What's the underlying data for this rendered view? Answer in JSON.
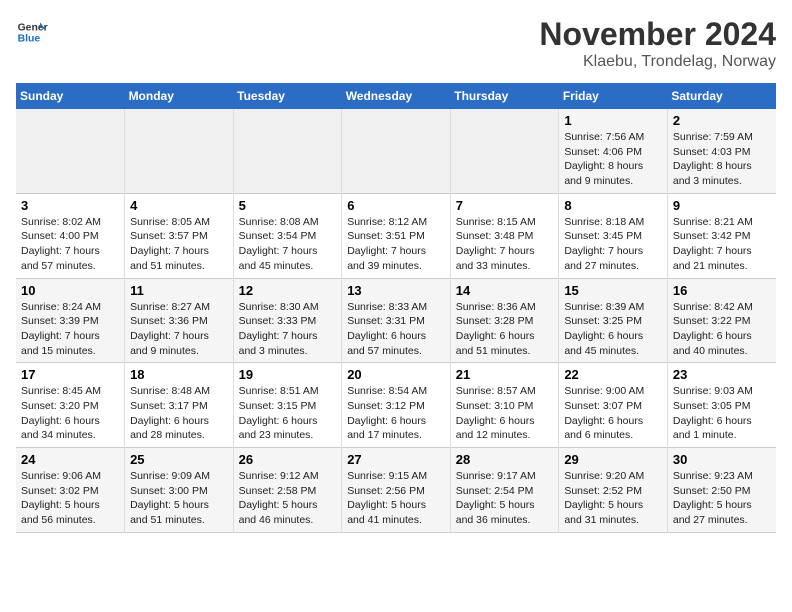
{
  "header": {
    "logo_line1": "General",
    "logo_line2": "Blue",
    "title": "November 2024",
    "subtitle": "Klaebu, Trondelag, Norway"
  },
  "weekdays": [
    "Sunday",
    "Monday",
    "Tuesday",
    "Wednesday",
    "Thursday",
    "Friday",
    "Saturday"
  ],
  "weeks": [
    [
      {
        "day": "",
        "info": ""
      },
      {
        "day": "",
        "info": ""
      },
      {
        "day": "",
        "info": ""
      },
      {
        "day": "",
        "info": ""
      },
      {
        "day": "",
        "info": ""
      },
      {
        "day": "1",
        "info": "Sunrise: 7:56 AM\nSunset: 4:06 PM\nDaylight: 8 hours and 9 minutes."
      },
      {
        "day": "2",
        "info": "Sunrise: 7:59 AM\nSunset: 4:03 PM\nDaylight: 8 hours and 3 minutes."
      }
    ],
    [
      {
        "day": "3",
        "info": "Sunrise: 8:02 AM\nSunset: 4:00 PM\nDaylight: 7 hours and 57 minutes."
      },
      {
        "day": "4",
        "info": "Sunrise: 8:05 AM\nSunset: 3:57 PM\nDaylight: 7 hours and 51 minutes."
      },
      {
        "day": "5",
        "info": "Sunrise: 8:08 AM\nSunset: 3:54 PM\nDaylight: 7 hours and 45 minutes."
      },
      {
        "day": "6",
        "info": "Sunrise: 8:12 AM\nSunset: 3:51 PM\nDaylight: 7 hours and 39 minutes."
      },
      {
        "day": "7",
        "info": "Sunrise: 8:15 AM\nSunset: 3:48 PM\nDaylight: 7 hours and 33 minutes."
      },
      {
        "day": "8",
        "info": "Sunrise: 8:18 AM\nSunset: 3:45 PM\nDaylight: 7 hours and 27 minutes."
      },
      {
        "day": "9",
        "info": "Sunrise: 8:21 AM\nSunset: 3:42 PM\nDaylight: 7 hours and 21 minutes."
      }
    ],
    [
      {
        "day": "10",
        "info": "Sunrise: 8:24 AM\nSunset: 3:39 PM\nDaylight: 7 hours and 15 minutes."
      },
      {
        "day": "11",
        "info": "Sunrise: 8:27 AM\nSunset: 3:36 PM\nDaylight: 7 hours and 9 minutes."
      },
      {
        "day": "12",
        "info": "Sunrise: 8:30 AM\nSunset: 3:33 PM\nDaylight: 7 hours and 3 minutes."
      },
      {
        "day": "13",
        "info": "Sunrise: 8:33 AM\nSunset: 3:31 PM\nDaylight: 6 hours and 57 minutes."
      },
      {
        "day": "14",
        "info": "Sunrise: 8:36 AM\nSunset: 3:28 PM\nDaylight: 6 hours and 51 minutes."
      },
      {
        "day": "15",
        "info": "Sunrise: 8:39 AM\nSunset: 3:25 PM\nDaylight: 6 hours and 45 minutes."
      },
      {
        "day": "16",
        "info": "Sunrise: 8:42 AM\nSunset: 3:22 PM\nDaylight: 6 hours and 40 minutes."
      }
    ],
    [
      {
        "day": "17",
        "info": "Sunrise: 8:45 AM\nSunset: 3:20 PM\nDaylight: 6 hours and 34 minutes."
      },
      {
        "day": "18",
        "info": "Sunrise: 8:48 AM\nSunset: 3:17 PM\nDaylight: 6 hours and 28 minutes."
      },
      {
        "day": "19",
        "info": "Sunrise: 8:51 AM\nSunset: 3:15 PM\nDaylight: 6 hours and 23 minutes."
      },
      {
        "day": "20",
        "info": "Sunrise: 8:54 AM\nSunset: 3:12 PM\nDaylight: 6 hours and 17 minutes."
      },
      {
        "day": "21",
        "info": "Sunrise: 8:57 AM\nSunset: 3:10 PM\nDaylight: 6 hours and 12 minutes."
      },
      {
        "day": "22",
        "info": "Sunrise: 9:00 AM\nSunset: 3:07 PM\nDaylight: 6 hours and 6 minutes."
      },
      {
        "day": "23",
        "info": "Sunrise: 9:03 AM\nSunset: 3:05 PM\nDaylight: 6 hours and 1 minute."
      }
    ],
    [
      {
        "day": "24",
        "info": "Sunrise: 9:06 AM\nSunset: 3:02 PM\nDaylight: 5 hours and 56 minutes."
      },
      {
        "day": "25",
        "info": "Sunrise: 9:09 AM\nSunset: 3:00 PM\nDaylight: 5 hours and 51 minutes."
      },
      {
        "day": "26",
        "info": "Sunrise: 9:12 AM\nSunset: 2:58 PM\nDaylight: 5 hours and 46 minutes."
      },
      {
        "day": "27",
        "info": "Sunrise: 9:15 AM\nSunset: 2:56 PM\nDaylight: 5 hours and 41 minutes."
      },
      {
        "day": "28",
        "info": "Sunrise: 9:17 AM\nSunset: 2:54 PM\nDaylight: 5 hours and 36 minutes."
      },
      {
        "day": "29",
        "info": "Sunrise: 9:20 AM\nSunset: 2:52 PM\nDaylight: 5 hours and 31 minutes."
      },
      {
        "day": "30",
        "info": "Sunrise: 9:23 AM\nSunset: 2:50 PM\nDaylight: 5 hours and 27 minutes."
      }
    ]
  ]
}
